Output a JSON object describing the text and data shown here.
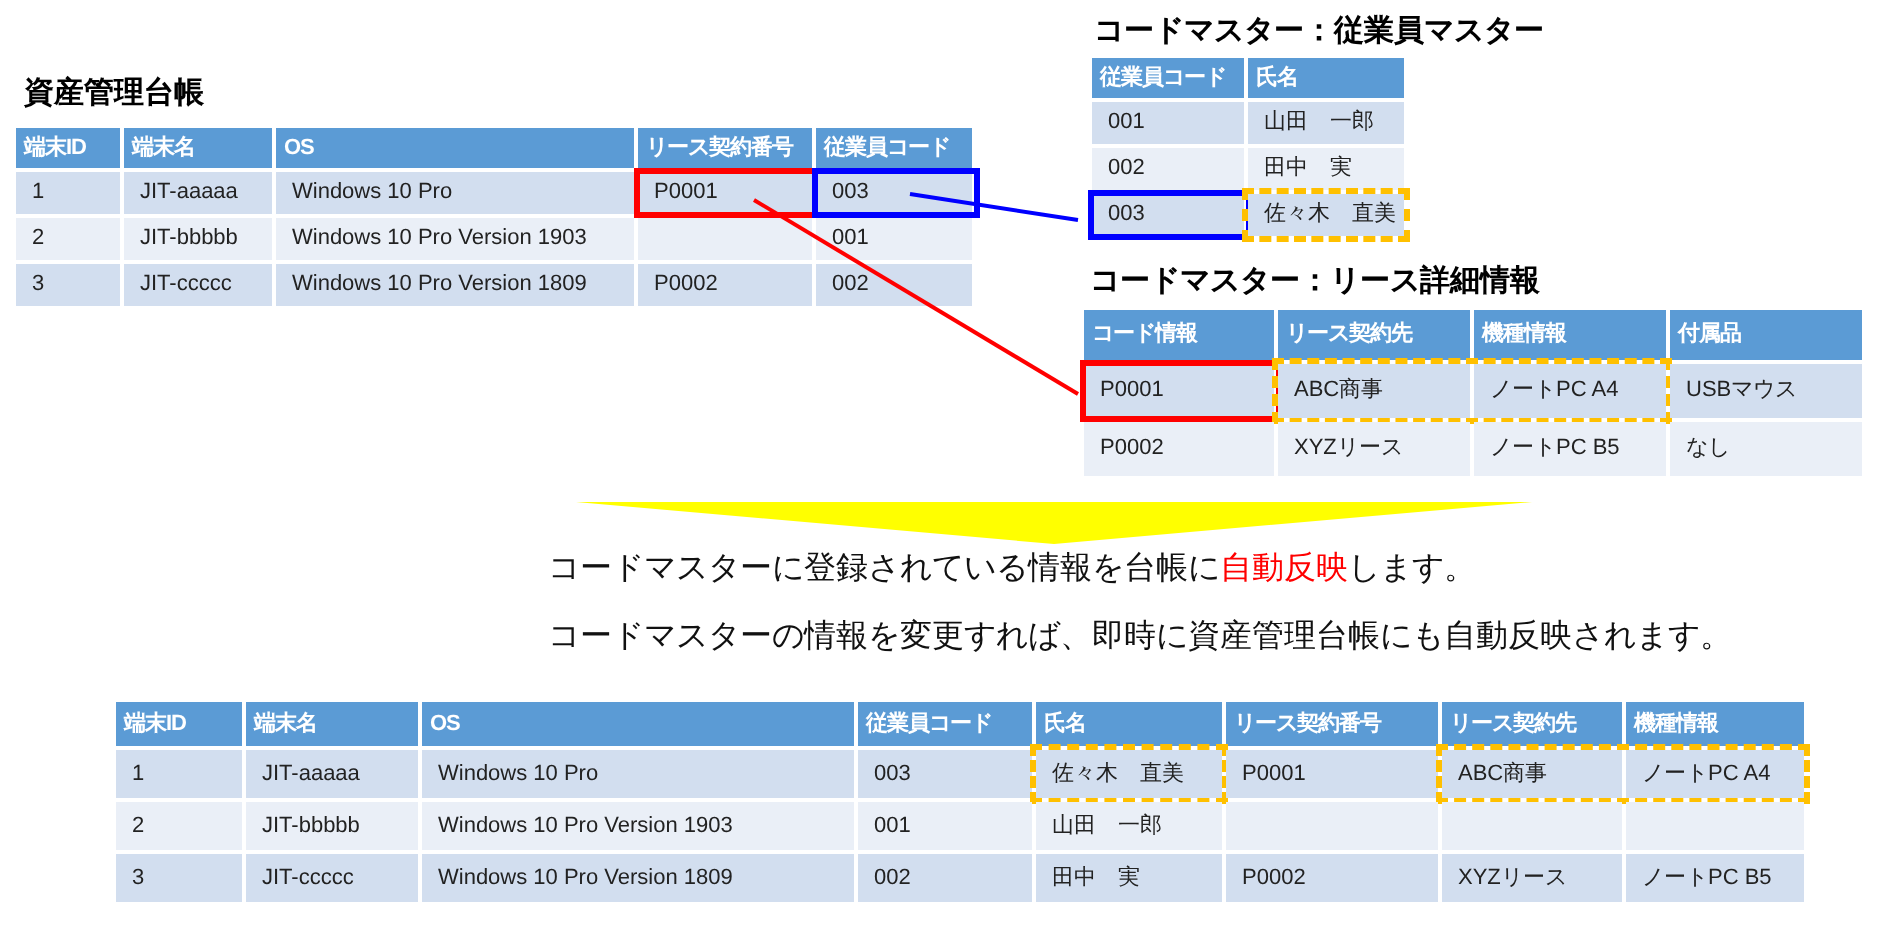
{
  "asset_ledger": {
    "title": "資産管理台帳",
    "columns": [
      "端末ID",
      "端末名",
      "OS",
      "リース契約番号",
      "従業員コード"
    ],
    "rows": [
      [
        "1",
        "JIT-aaaaa",
        "Windows 10 Pro",
        {
          "text": "P0001",
          "dashed": false,
          "color": "#ff0000"
        },
        {
          "text": "003",
          "dashed": false,
          "color": "#0000ff"
        }
      ],
      [
        "2",
        "JIT-bbbbb",
        "Windows 10 Pro Version 1903",
        null,
        "001"
      ],
      [
        "3",
        "JIT-ccccc",
        "Windows 10 Pro Version 1809",
        "P0002",
        "002"
      ]
    ]
  },
  "employee_master": {
    "title": "コードマスター：従業員マスター",
    "columns": [
      "従業員コード",
      "氏名"
    ],
    "rows": [
      [
        "001",
        "山田　一郎"
      ],
      [
        "002",
        "田中　実"
      ],
      [
        {
          "text": "003",
          "dashed": false,
          "color": "#0000ff"
        },
        {
          "text": "佐々木　直美",
          "dashed": true,
          "color": "#ffc000"
        }
      ]
    ]
  },
  "lease_master": {
    "title": "コードマスター：リース詳細情報",
    "columns": [
      "コード情報",
      "リース契約先",
      "機種情報",
      "付属品"
    ],
    "rows": [
      [
        {
          "text": "P0001",
          "dashed": false,
          "color": "#ff0000"
        },
        {
          "text": "ABC商事",
          "dashed": true,
          "color": "#ffc000"
        },
        {
          "text": "ノートPC A4",
          "dashed": true,
          "color": "#ffc000"
        },
        "USBマウス"
      ],
      [
        "P0002",
        "XYZリース",
        "ノートPC B5",
        "なし"
      ]
    ]
  },
  "messages": [
    [
      {
        "text": "コードマスターに登録されている情報を台帳に",
        "emphasis": false
      },
      {
        "text": "自動反映",
        "emphasis": true
      },
      {
        "text": "します。",
        "emphasis": false
      }
    ],
    [
      {
        "text": "コードマスターの情報を変更すれば、即時に資産管理台帳にも自動反映されます。",
        "emphasis": false
      }
    ]
  ],
  "result_table": {
    "columns": [
      "端末ID",
      "端末名",
      "OS",
      "従業員コード",
      "氏名",
      "リース契約番号",
      "リース契約先",
      "機種情報"
    ],
    "rows": [
      [
        "1",
        "JIT-aaaaa",
        "Windows 10 Pro",
        "003",
        {
          "text": "佐々木　直美",
          "dashed": true,
          "color": "#ffc000"
        },
        "P0001",
        {
          "text": "ABC商事",
          "dashed": true,
          "color": "#ffc000"
        },
        {
          "text": "ノートPC A4",
          "dashed": true,
          "color": "#ffc000"
        }
      ],
      [
        "2",
        "JIT-bbbbb",
        "Windows 10 Pro Version 1903",
        "001",
        "山田　一郎",
        null,
        null,
        null
      ],
      [
        "3",
        "JIT-ccccc",
        "Windows 10 Pro Version 1809",
        "002",
        "田中　実",
        "P0002",
        "XYZリース",
        "ノートPC B5"
      ]
    ]
  }
}
